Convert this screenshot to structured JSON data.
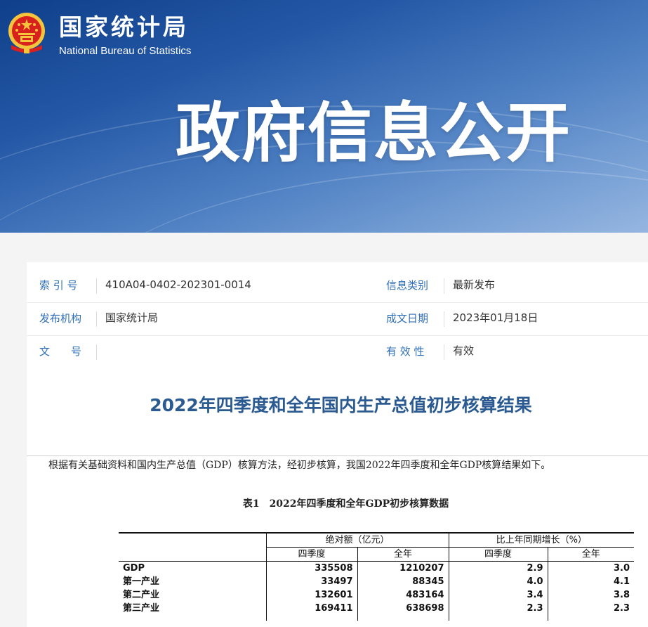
{
  "header": {
    "site_name_cn": "国家统计局",
    "site_name_en": "National Bureau of Statistics",
    "banner_title": "政府信息公开",
    "colors": {
      "banner": "#2458a6",
      "emblem_red": "#d8201e",
      "emblem_gold": "#f4c43c"
    }
  },
  "info": {
    "index_label": "索 引 号",
    "index_value": "410A04-0402-202301-0014",
    "category_label": "信息类别",
    "category_value": "最新发布",
    "publisher_label": "发布机构",
    "publisher_value": "国家统计局",
    "date_label": "成文日期",
    "date_value": "2023年01月18日",
    "doc_no_label": "文　　号",
    "doc_no_value": "",
    "validity_label": "有 效 性",
    "validity_value": "有效",
    "label_color": "#2f6fb5"
  },
  "article": {
    "title": "2022年四季度和全年国内生产总值初步核算结果",
    "intro": "根据有关基础资料和国内生产总值（GDP）核算方法，经初步核算，我国2022年四季度和全年GDP核算结果如下。",
    "table_caption": "表1　2022年四季度和全年GDP初步核算数据",
    "table": {
      "group_headers": [
        "绝对额（亿元）",
        "比上年同期增长（%）"
      ],
      "sub_headers": [
        "四季度",
        "全年",
        "四季度",
        "全年"
      ],
      "rows": [
        {
          "name": "GDP",
          "values": [
            "335508",
            "1210207",
            "2.9",
            "3.0"
          ]
        },
        {
          "name": "第一产业",
          "values": [
            "33497",
            "88345",
            "4.0",
            "4.1"
          ]
        },
        {
          "name": "第二产业",
          "values": [
            "132601",
            "483164",
            "3.4",
            "3.8"
          ]
        },
        {
          "name": "第三产业",
          "values": [
            "169411",
            "638698",
            "2.3",
            "2.3"
          ]
        }
      ]
    }
  }
}
